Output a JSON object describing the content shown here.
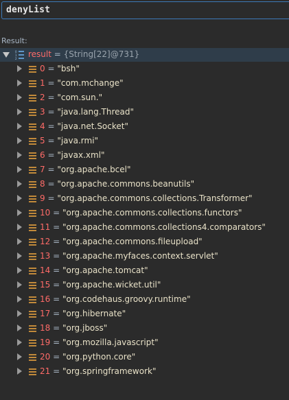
{
  "expression": {
    "value": "denyList"
  },
  "result_label": "Result:",
  "root": {
    "name": "result",
    "eq": " = ",
    "meta": "{String[22]@731}"
  },
  "items": [
    {
      "index": "0",
      "value": "\"bsh\""
    },
    {
      "index": "1",
      "value": "\"com.mchange\""
    },
    {
      "index": "2",
      "value": "\"com.sun.\""
    },
    {
      "index": "3",
      "value": "\"java.lang.Thread\""
    },
    {
      "index": "4",
      "value": "\"java.net.Socket\""
    },
    {
      "index": "5",
      "value": "\"java.rmi\""
    },
    {
      "index": "6",
      "value": "\"javax.xml\""
    },
    {
      "index": "7",
      "value": "\"org.apache.bcel\""
    },
    {
      "index": "8",
      "value": "\"org.apache.commons.beanutils\""
    },
    {
      "index": "9",
      "value": "\"org.apache.commons.collections.Transformer\""
    },
    {
      "index": "10",
      "value": "\"org.apache.commons.collections.functors\""
    },
    {
      "index": "11",
      "value": "\"org.apache.commons.collections4.comparators\""
    },
    {
      "index": "12",
      "value": "\"org.apache.commons.fileupload\""
    },
    {
      "index": "13",
      "value": "\"org.apache.myfaces.context.servlet\""
    },
    {
      "index": "14",
      "value": "\"org.apache.tomcat\""
    },
    {
      "index": "15",
      "value": "\"org.apache.wicket.util\""
    },
    {
      "index": "16",
      "value": "\"org.codehaus.groovy.runtime\""
    },
    {
      "index": "17",
      "value": "\"org.hibernate\""
    },
    {
      "index": "18",
      "value": "\"org.jboss\""
    },
    {
      "index": "19",
      "value": "\"org.mozilla.javascript\""
    },
    {
      "index": "20",
      "value": "\"org.python.core\""
    },
    {
      "index": "21",
      "value": "\"org.springframework\""
    }
  ],
  "colors": {
    "background": "#2b2b2b",
    "selection": "#2f3d4a",
    "field_name": "#ff6b68",
    "string_value": "#e9e2c8",
    "field_icon": "#c28a3a",
    "input_border": "#3d7ab8"
  },
  "icons": {
    "root_toggle": "chevron-down-icon",
    "item_toggle": "chevron-right-icon",
    "root_type": "array-icon",
    "item_type": "field-icon"
  }
}
